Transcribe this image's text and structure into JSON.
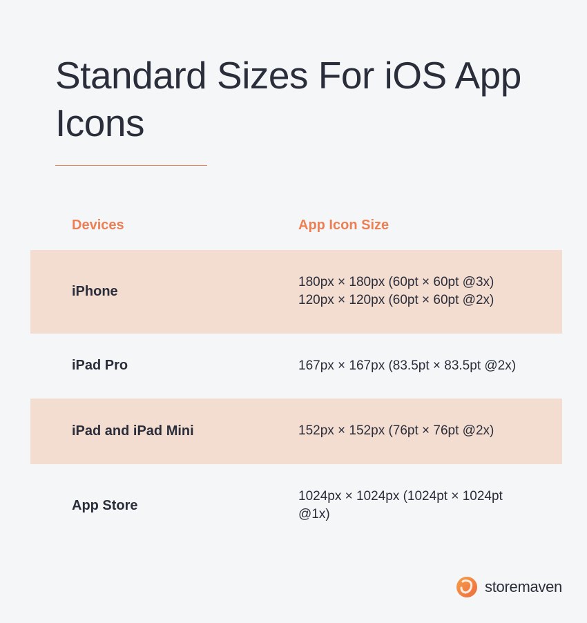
{
  "title": "Standard Sizes For iOS App Icons",
  "headers": {
    "devices": "Devices",
    "size": "App Icon Size"
  },
  "rows": [
    {
      "device": "iPhone",
      "size": "180px × 180px (60pt × 60pt @3x)\n120px × 120px (60pt × 60pt @2x)",
      "shaded": true
    },
    {
      "device": "iPad Pro",
      "size": "167px × 167px (83.5pt × 83.5pt @2x)",
      "shaded": false
    },
    {
      "device": "iPad and iPad Mini",
      "size": "152px × 152px (76pt × 76pt @2x)",
      "shaded": true
    },
    {
      "device": "App Store",
      "size": "1024px × 1024px (1024pt × 1024pt @1x)",
      "shaded": false
    }
  ],
  "brand": "storemaven"
}
